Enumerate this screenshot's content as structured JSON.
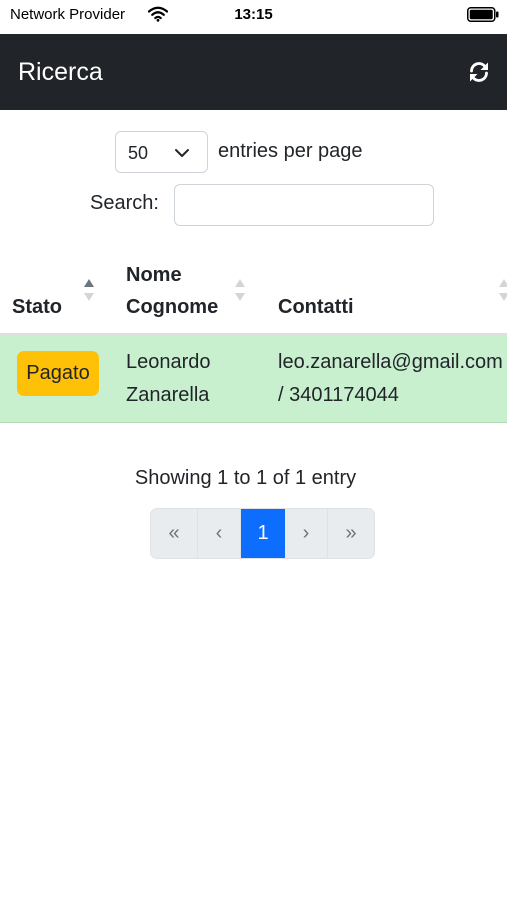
{
  "status_bar": {
    "carrier": "Network Provider",
    "time": "13:15"
  },
  "navbar": {
    "title": "Ricerca",
    "refresh_icon": "refresh-icon"
  },
  "length": {
    "value": "50",
    "label": "entries per page"
  },
  "search": {
    "label": "Search:",
    "value": "",
    "placeholder": ""
  },
  "table": {
    "headers": {
      "stato": "Stato",
      "nome_line1": "Nome",
      "nome_line2": "Cognome",
      "contatti": "Contatti"
    },
    "rows": [
      {
        "status": "Pagato",
        "status_color": "#ffc107",
        "nome": "Leonardo",
        "cognome": "Zanarella",
        "email": "leo.zanarella@gmail.com",
        "phone": "/ 3401174044"
      }
    ]
  },
  "info": "Showing 1 to 1 of 1 entry",
  "pagination": {
    "first": "«",
    "prev": "‹",
    "current": "1",
    "next": "›",
    "last": "»"
  },
  "colors": {
    "navbar": "#212529",
    "row_highlight": "#c8f0cf",
    "active_page": "#0d6efd",
    "badge": "#ffc107"
  }
}
